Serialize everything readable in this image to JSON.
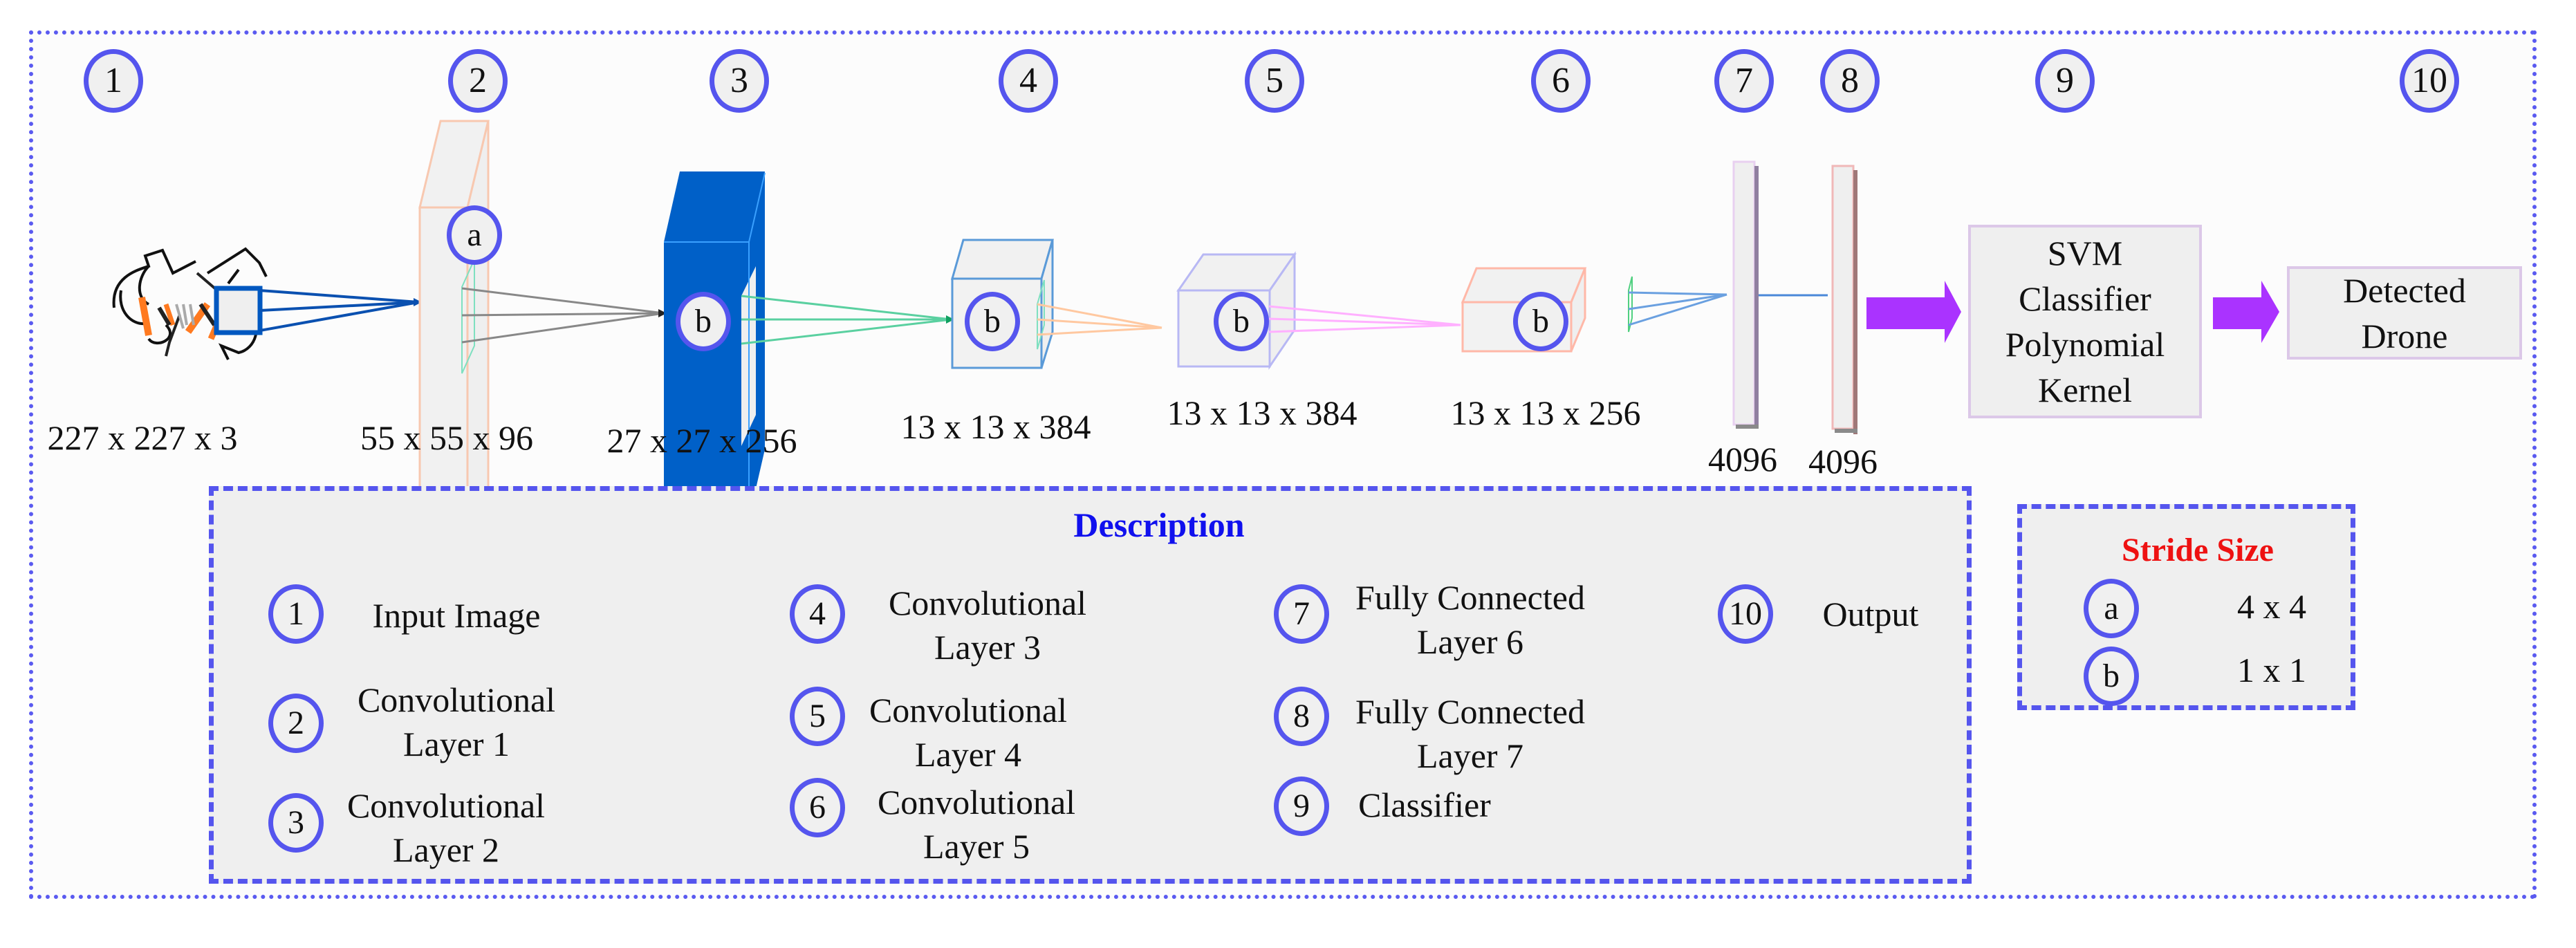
{
  "pipeline": {
    "step_numbers": [
      "1",
      "2",
      "3",
      "4",
      "5",
      "6",
      "7",
      "8",
      "9",
      "10"
    ],
    "stride_markers": {
      "layer2": "a",
      "layer3": "b",
      "layer4": "b",
      "layer5": "b",
      "layer6": "b"
    },
    "dimensions": {
      "input": "227 x 227 x 3",
      "conv1": "55 x 55 x 96",
      "conv2": "27 x 27 x 256",
      "conv3": "13 x 13 x 384",
      "conv4": "13 x 13 x 384",
      "conv5": "13 x 13 x 256",
      "fc6": "4096",
      "fc7": "4096"
    },
    "classifier_box": {
      "lines": [
        "SVM",
        "Classifier",
        "Polynomial",
        "Kernel"
      ]
    },
    "output_box": {
      "lines": [
        "Detected",
        "Drone"
      ]
    },
    "input_image_icon": "drone-image"
  },
  "description": {
    "title": "Description",
    "items": [
      {
        "num": "1",
        "lines": [
          "Input Image"
        ]
      },
      {
        "num": "2",
        "lines": [
          "Convolutional",
          "Layer 1"
        ]
      },
      {
        "num": "3",
        "lines": [
          "Convolutional",
          "Layer 2"
        ]
      },
      {
        "num": "4",
        "lines": [
          "Convolutional",
          "Layer 3"
        ]
      },
      {
        "num": "5",
        "lines": [
          "Convolutional",
          "Layer 4"
        ]
      },
      {
        "num": "6",
        "lines": [
          "Convolutional",
          "Layer 5"
        ]
      },
      {
        "num": "7",
        "lines": [
          "Fully Connected",
          "Layer 6"
        ]
      },
      {
        "num": "8",
        "lines": [
          "Fully Connected",
          "Layer 7"
        ]
      },
      {
        "num": "9",
        "lines": [
          "Classifier"
        ]
      },
      {
        "num": "10",
        "lines": [
          "Output"
        ]
      }
    ]
  },
  "stride": {
    "title": "Stride Size",
    "rows": [
      {
        "key": "a",
        "value": "4 x 4"
      },
      {
        "key": "b",
        "value": "1 x 1"
      }
    ]
  },
  "colors": {
    "frame": "#5a5af0",
    "circle_border": "#5555ee",
    "description_title": "#1010ee",
    "stride_title": "#ee1111",
    "conv2_fill": "#0060c8",
    "arrow": "#aa33ff"
  }
}
